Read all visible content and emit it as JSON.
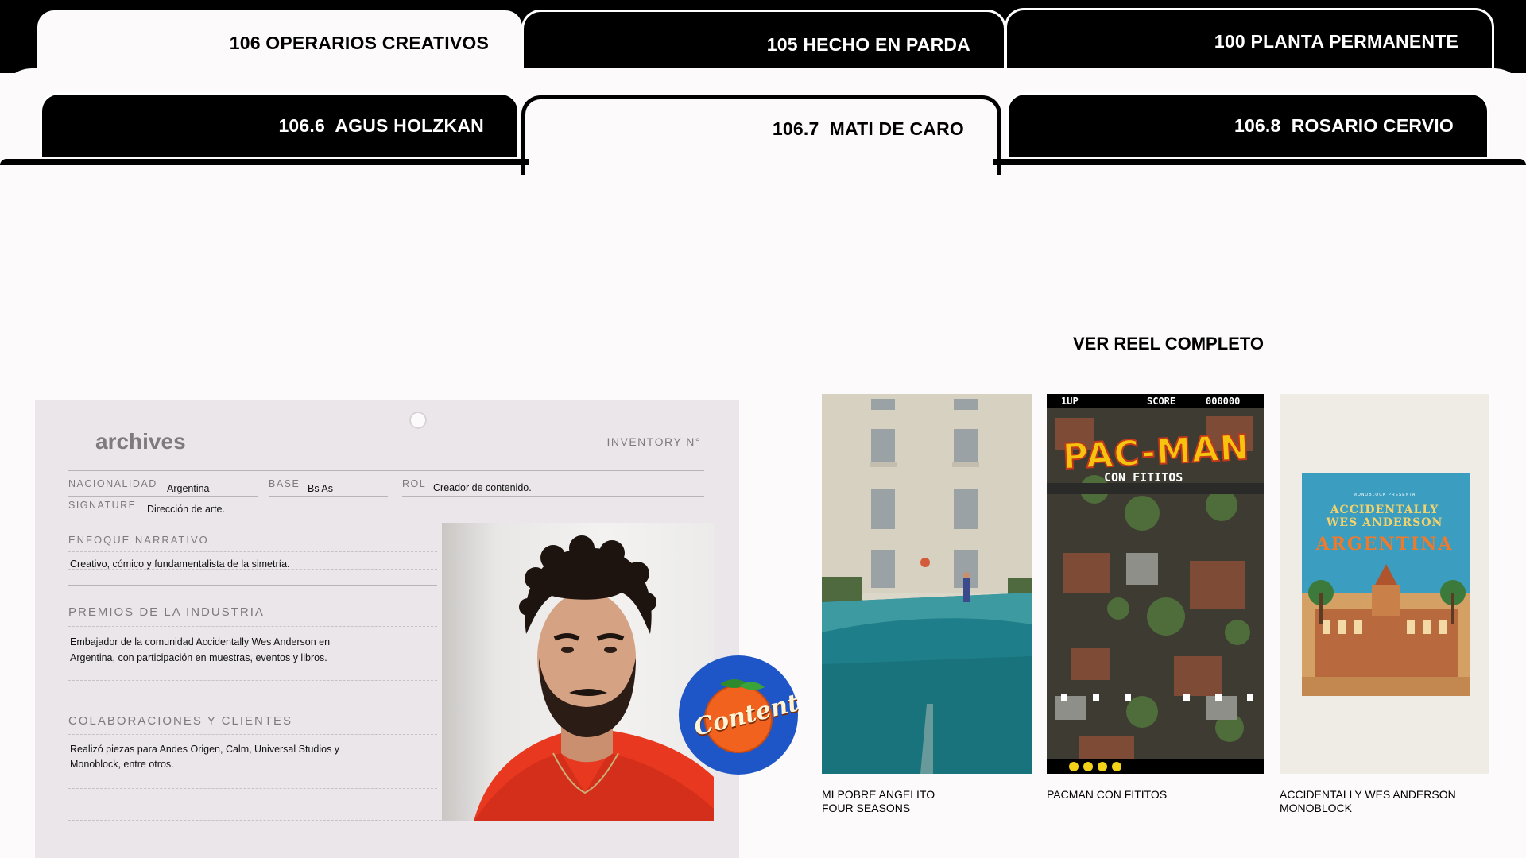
{
  "tabs_row1": [
    {
      "label": "106 OPERARIOS CREATIVOS"
    },
    {
      "label": "105 HECHO EN PARDA"
    },
    {
      "label": "100 PLANTA PERMANENTE"
    }
  ],
  "tabs_row2": [
    {
      "label": "106.6  AGUS HOLZKAN"
    },
    {
      "label": "106.7  MATI DE CARO"
    },
    {
      "label": "106.8  ROSARIO CERVIO"
    }
  ],
  "reel_link": "VER REEL COMPLETO",
  "card": {
    "brand": "archives",
    "inventory": "INVENTORY N°",
    "fields": {
      "nacionalidad_label": "NACIONALIDAD",
      "nacionalidad_value": "Argentina",
      "base_label": "BASE",
      "base_value": "Bs As",
      "rol_label": "ROL",
      "rol_value": "Creador de contenido.",
      "signature_label": "SIGNATURE",
      "signature_value": "Dirección de arte."
    },
    "sections": {
      "enfoque_title": "ENFOQUE NARRATIVO",
      "enfoque_text": "Creativo, cómico y fundamentalista de la simetría.",
      "premios_title": "PREMIOS DE LA INDUSTRIA",
      "premios_line1": "Embajador de la comunidad Accidentally Wes Anderson en",
      "premios_line2": "Argentina, con participación en muestras, eventos y libros.",
      "colab_title": "COLABORACIONES Y CLIENTES",
      "colab_line1": "Realizó piezas para Andes Origen, Calm, Universal Studios y",
      "colab_line2": "Monoblock, entre otros."
    }
  },
  "badge": {
    "text": "Content"
  },
  "works": [
    {
      "line1": "MI POBRE ANGELITO",
      "line2": "FOUR SEASONS"
    },
    {
      "line1": "PACMAN CON FITITOS",
      "line2": "",
      "poster": {
        "oneup": "1UP",
        "score": "SCORE",
        "score_value": "000000",
        "title": "PAC-MAN",
        "subtitle": "CON FITITOS"
      }
    },
    {
      "line1": "ACCIDENTALLY WES ANDERSON",
      "line2": "MONOBLOCK",
      "poster": {
        "top": "MONOBLOCK PRESENTA",
        "title1": "ACCIDENTALLY",
        "title2": "WES ANDERSON",
        "title3": "ARGENTINA"
      }
    }
  ]
}
